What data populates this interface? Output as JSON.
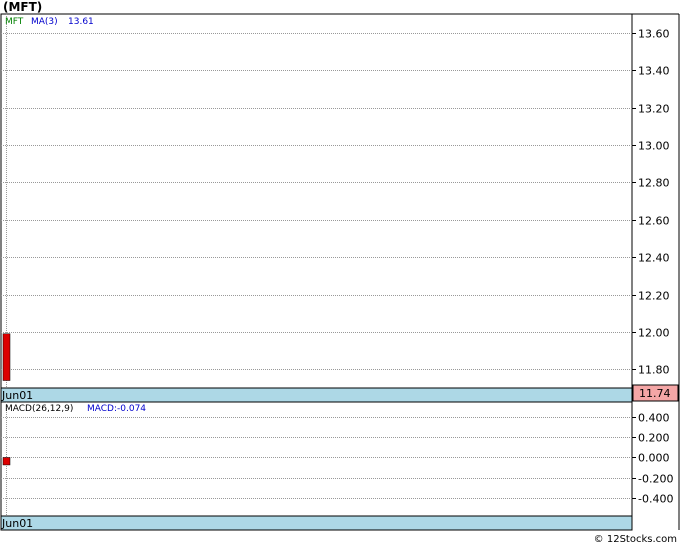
{
  "title": "(MFT)",
  "footer": "© 12Stocks.com",
  "chart_data": [
    {
      "type": "bar",
      "name": "price",
      "legend": {
        "symbol": "MFT",
        "ma_label": "MA(3)",
        "ma_value": "13.61"
      },
      "x_label": "Jun01",
      "ylim": [
        11.7,
        13.7
      ],
      "ticks": [
        11.8,
        12.0,
        12.2,
        12.4,
        12.6,
        12.8,
        13.0,
        13.2,
        13.4,
        13.6
      ],
      "tick_labels": [
        "11.80",
        "12.00",
        "12.20",
        "12.40",
        "12.60",
        "12.80",
        "13.00",
        "13.20",
        "13.40",
        "13.60"
      ],
      "bars": [
        {
          "x": "Jun01",
          "open": 11.99,
          "close": 11.74,
          "color": "#dd0000"
        }
      ],
      "last_price_label": "11.74",
      "grid": true,
      "colors": {
        "symbol": "#008000",
        "ma": "#0000cc",
        "bar": "#dd0000",
        "axis_band": "#add8e6",
        "price_badge": "#f4a6a6"
      }
    },
    {
      "type": "bar",
      "name": "macd",
      "legend": {
        "label": "MACD(26,12,9)",
        "value_label": "MACD:-0.074"
      },
      "x_label": "Jun01",
      "ylim": [
        -0.58,
        0.55
      ],
      "ticks": [
        -0.4,
        -0.2,
        0.0,
        0.2,
        0.4
      ],
      "tick_labels": [
        "-0.400",
        "-0.200",
        "0.000",
        "0.200",
        "0.400"
      ],
      "values": [
        -0.074
      ],
      "grid": true,
      "colors": {
        "value": "#0000cc",
        "bar": "#dd0000",
        "axis_band": "#add8e6"
      }
    }
  ]
}
